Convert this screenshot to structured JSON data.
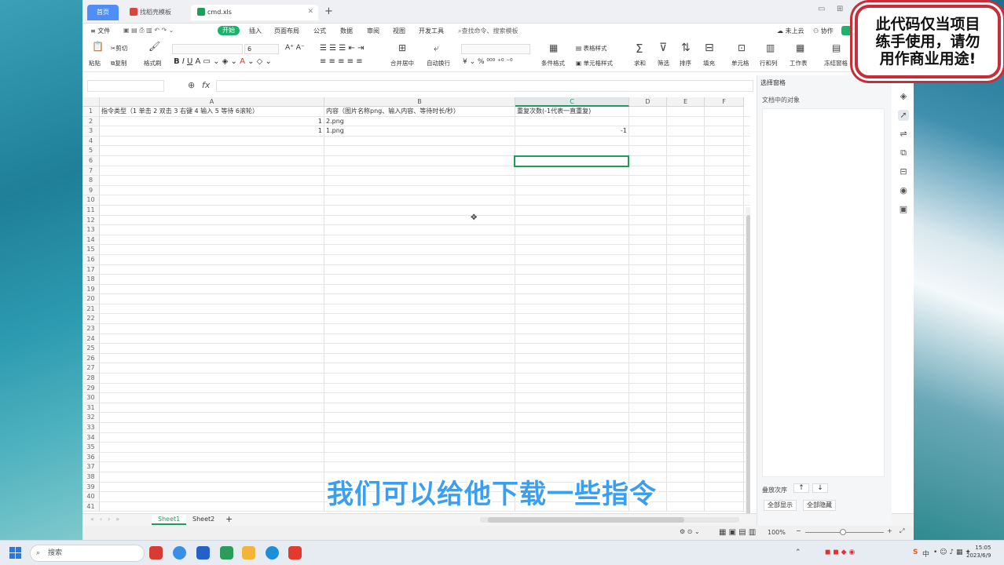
{
  "tabs": {
    "home": "首页",
    "template": "找稻壳模板",
    "document": "cmd.xls",
    "add": "+"
  },
  "menu": {
    "items": [
      "≡ 文件",
      "插入",
      "页面布局",
      "公式",
      "数据",
      "审阅",
      "视图",
      "开发工具"
    ],
    "active": "开始",
    "search": "查找命令、搜索模板",
    "cloud": "未上云",
    "collab": "协作"
  },
  "ribbon": {
    "paste": "粘贴",
    "cut": "剪切",
    "copy": "复制",
    "format_painter": "格式刷",
    "font_size": "6",
    "merge": "合并居中",
    "wrap": "自动换行",
    "cond_format": "条件格式",
    "table_style": "表格样式",
    "cell_style": "单元格样式",
    "sum": "求和",
    "filter": "筛选",
    "sort": "排序",
    "fill": "填充",
    "cell": "单元格",
    "rowcol": "行和列",
    "worksheet": "工作表",
    "freeze": "冻结窗格"
  },
  "formula_bar": {
    "fx": "fx",
    "value": ""
  },
  "sheet": {
    "columns": [
      "A",
      "B",
      "C",
      "D",
      "E",
      "F"
    ],
    "selected_column": "C",
    "rows": [
      {
        "n": "1",
        "a": "指令类型（1 单击  2 双击  3 右键  4 输入  5 等待  6滚轮）",
        "b": "内容（图片名称png、输入内容、等待时长/秒）",
        "c": "重复次数(-1代表一直重复)"
      },
      {
        "n": "2",
        "a": "1",
        "b": "2.png",
        "c": ""
      },
      {
        "n": "3",
        "a": "1",
        "b": "1.png",
        "c": "-1"
      },
      {
        "n": "4",
        "a": "",
        "b": "",
        "c": ""
      },
      {
        "n": "5",
        "a": "",
        "b": "",
        "c": ""
      },
      {
        "n": "6",
        "a": "",
        "b": "",
        "c": ""
      },
      {
        "n": "7",
        "a": "",
        "b": "",
        "c": ""
      },
      {
        "n": "8",
        "a": "",
        "b": "",
        "c": ""
      },
      {
        "n": "9",
        "a": "",
        "b": "",
        "c": ""
      },
      {
        "n": "10",
        "a": "",
        "b": "",
        "c": ""
      },
      {
        "n": "11",
        "a": "",
        "b": "",
        "c": ""
      },
      {
        "n": "12",
        "a": "",
        "b": "",
        "c": ""
      },
      {
        "n": "13",
        "a": "",
        "b": "",
        "c": ""
      },
      {
        "n": "14",
        "a": "",
        "b": "",
        "c": ""
      },
      {
        "n": "15",
        "a": "",
        "b": "",
        "c": ""
      },
      {
        "n": "16",
        "a": "",
        "b": "",
        "c": ""
      },
      {
        "n": "17",
        "a": "",
        "b": "",
        "c": ""
      },
      {
        "n": "18",
        "a": "",
        "b": "",
        "c": ""
      },
      {
        "n": "19",
        "a": "",
        "b": "",
        "c": ""
      },
      {
        "n": "20",
        "a": "",
        "b": "",
        "c": ""
      },
      {
        "n": "21",
        "a": "",
        "b": "",
        "c": ""
      },
      {
        "n": "22",
        "a": "",
        "b": "",
        "c": ""
      },
      {
        "n": "23",
        "a": "",
        "b": "",
        "c": ""
      },
      {
        "n": "24",
        "a": "",
        "b": "",
        "c": ""
      },
      {
        "n": "25",
        "a": "",
        "b": "",
        "c": ""
      },
      {
        "n": "26",
        "a": "",
        "b": "",
        "c": ""
      },
      {
        "n": "27",
        "a": "",
        "b": "",
        "c": ""
      },
      {
        "n": "28",
        "a": "",
        "b": "",
        "c": ""
      },
      {
        "n": "29",
        "a": "",
        "b": "",
        "c": ""
      },
      {
        "n": "30",
        "a": "",
        "b": "",
        "c": ""
      },
      {
        "n": "31",
        "a": "",
        "b": "",
        "c": ""
      },
      {
        "n": "32",
        "a": "",
        "b": "",
        "c": ""
      },
      {
        "n": "33",
        "a": "",
        "b": "",
        "c": ""
      },
      {
        "n": "34",
        "a": "",
        "b": "",
        "c": ""
      },
      {
        "n": "35",
        "a": "",
        "b": "",
        "c": ""
      },
      {
        "n": "36",
        "a": "",
        "b": "",
        "c": ""
      },
      {
        "n": "37",
        "a": "",
        "b": "",
        "c": ""
      },
      {
        "n": "38",
        "a": "",
        "b": "",
        "c": ""
      },
      {
        "n": "39",
        "a": "",
        "b": "",
        "c": ""
      },
      {
        "n": "40",
        "a": "",
        "b": "",
        "c": ""
      },
      {
        "n": "41",
        "a": "",
        "b": "",
        "c": ""
      }
    ]
  },
  "sheet_tabs": [
    "Sheet1",
    "Sheet2"
  ],
  "status": {
    "zoom": "100%"
  },
  "panel": {
    "title": "选择窗格",
    "objects_label": "文档中的对象",
    "order_label": "叠放次序",
    "show_all": "全部显示",
    "hide_all": "全部隐藏"
  },
  "watermark": {
    "line1": "此代码仅当项目",
    "line2": "练手使用，请勿",
    "line3": "用作商业用途!"
  },
  "caption": "我们可以给他下载一些指令",
  "taskbar": {
    "search": "搜索",
    "time": "15:05",
    "date": "2023/6/9",
    "ime": "中"
  },
  "colors": {
    "accent": "#1d9d5b",
    "home_tab": "#4f8ef7",
    "stamp": "#c82d3a",
    "caption": "#3a9ff0"
  }
}
